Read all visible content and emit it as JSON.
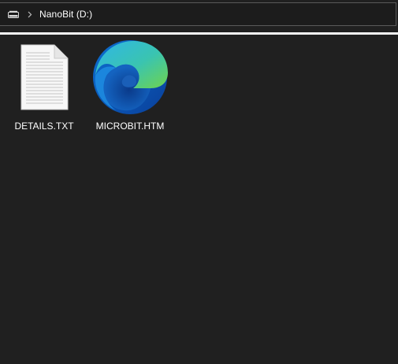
{
  "address_bar": {
    "drive_icon": "drive-icon",
    "separator_icon": "chevron-right-icon",
    "location": "NanoBit (D:)"
  },
  "files": [
    {
      "name": "DETAILS.TXT",
      "icon": "text-document-icon"
    },
    {
      "name": "MICROBIT.HTM",
      "icon": "edge-browser-icon"
    }
  ],
  "colors": {
    "background": "#202020",
    "text": "#ffffff",
    "divider": "#f5f5f5",
    "border": "#5a5a5a"
  }
}
